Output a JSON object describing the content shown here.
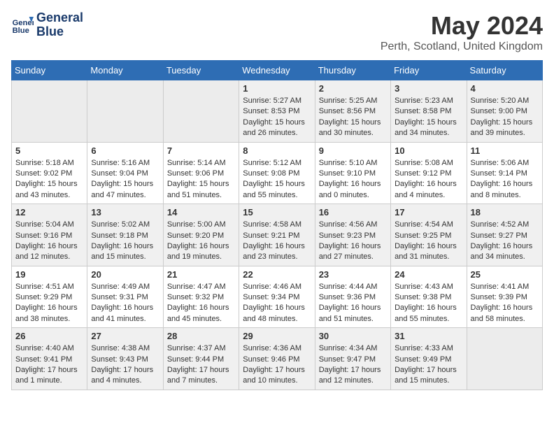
{
  "header": {
    "logo_line1": "General",
    "logo_line2": "Blue",
    "month_title": "May 2024",
    "location": "Perth, Scotland, United Kingdom"
  },
  "weekdays": [
    "Sunday",
    "Monday",
    "Tuesday",
    "Wednesday",
    "Thursday",
    "Friday",
    "Saturday"
  ],
  "rows": [
    [
      {
        "day": "",
        "info": ""
      },
      {
        "day": "",
        "info": ""
      },
      {
        "day": "",
        "info": ""
      },
      {
        "day": "1",
        "info": "Sunrise: 5:27 AM\nSunset: 8:53 PM\nDaylight: 15 hours\nand 26 minutes."
      },
      {
        "day": "2",
        "info": "Sunrise: 5:25 AM\nSunset: 8:56 PM\nDaylight: 15 hours\nand 30 minutes."
      },
      {
        "day": "3",
        "info": "Sunrise: 5:23 AM\nSunset: 8:58 PM\nDaylight: 15 hours\nand 34 minutes."
      },
      {
        "day": "4",
        "info": "Sunrise: 5:20 AM\nSunset: 9:00 PM\nDaylight: 15 hours\nand 39 minutes."
      }
    ],
    [
      {
        "day": "5",
        "info": "Sunrise: 5:18 AM\nSunset: 9:02 PM\nDaylight: 15 hours\nand 43 minutes."
      },
      {
        "day": "6",
        "info": "Sunrise: 5:16 AM\nSunset: 9:04 PM\nDaylight: 15 hours\nand 47 minutes."
      },
      {
        "day": "7",
        "info": "Sunrise: 5:14 AM\nSunset: 9:06 PM\nDaylight: 15 hours\nand 51 minutes."
      },
      {
        "day": "8",
        "info": "Sunrise: 5:12 AM\nSunset: 9:08 PM\nDaylight: 15 hours\nand 55 minutes."
      },
      {
        "day": "9",
        "info": "Sunrise: 5:10 AM\nSunset: 9:10 PM\nDaylight: 16 hours\nand 0 minutes."
      },
      {
        "day": "10",
        "info": "Sunrise: 5:08 AM\nSunset: 9:12 PM\nDaylight: 16 hours\nand 4 minutes."
      },
      {
        "day": "11",
        "info": "Sunrise: 5:06 AM\nSunset: 9:14 PM\nDaylight: 16 hours\nand 8 minutes."
      }
    ],
    [
      {
        "day": "12",
        "info": "Sunrise: 5:04 AM\nSunset: 9:16 PM\nDaylight: 16 hours\nand 12 minutes."
      },
      {
        "day": "13",
        "info": "Sunrise: 5:02 AM\nSunset: 9:18 PM\nDaylight: 16 hours\nand 15 minutes."
      },
      {
        "day": "14",
        "info": "Sunrise: 5:00 AM\nSunset: 9:20 PM\nDaylight: 16 hours\nand 19 minutes."
      },
      {
        "day": "15",
        "info": "Sunrise: 4:58 AM\nSunset: 9:21 PM\nDaylight: 16 hours\nand 23 minutes."
      },
      {
        "day": "16",
        "info": "Sunrise: 4:56 AM\nSunset: 9:23 PM\nDaylight: 16 hours\nand 27 minutes."
      },
      {
        "day": "17",
        "info": "Sunrise: 4:54 AM\nSunset: 9:25 PM\nDaylight: 16 hours\nand 31 minutes."
      },
      {
        "day": "18",
        "info": "Sunrise: 4:52 AM\nSunset: 9:27 PM\nDaylight: 16 hours\nand 34 minutes."
      }
    ],
    [
      {
        "day": "19",
        "info": "Sunrise: 4:51 AM\nSunset: 9:29 PM\nDaylight: 16 hours\nand 38 minutes."
      },
      {
        "day": "20",
        "info": "Sunrise: 4:49 AM\nSunset: 9:31 PM\nDaylight: 16 hours\nand 41 minutes."
      },
      {
        "day": "21",
        "info": "Sunrise: 4:47 AM\nSunset: 9:32 PM\nDaylight: 16 hours\nand 45 minutes."
      },
      {
        "day": "22",
        "info": "Sunrise: 4:46 AM\nSunset: 9:34 PM\nDaylight: 16 hours\nand 48 minutes."
      },
      {
        "day": "23",
        "info": "Sunrise: 4:44 AM\nSunset: 9:36 PM\nDaylight: 16 hours\nand 51 minutes."
      },
      {
        "day": "24",
        "info": "Sunrise: 4:43 AM\nSunset: 9:38 PM\nDaylight: 16 hours\nand 55 minutes."
      },
      {
        "day": "25",
        "info": "Sunrise: 4:41 AM\nSunset: 9:39 PM\nDaylight: 16 hours\nand 58 minutes."
      }
    ],
    [
      {
        "day": "26",
        "info": "Sunrise: 4:40 AM\nSunset: 9:41 PM\nDaylight: 17 hours\nand 1 minute."
      },
      {
        "day": "27",
        "info": "Sunrise: 4:38 AM\nSunset: 9:43 PM\nDaylight: 17 hours\nand 4 minutes."
      },
      {
        "day": "28",
        "info": "Sunrise: 4:37 AM\nSunset: 9:44 PM\nDaylight: 17 hours\nand 7 minutes."
      },
      {
        "day": "29",
        "info": "Sunrise: 4:36 AM\nSunset: 9:46 PM\nDaylight: 17 hours\nand 10 minutes."
      },
      {
        "day": "30",
        "info": "Sunrise: 4:34 AM\nSunset: 9:47 PM\nDaylight: 17 hours\nand 12 minutes."
      },
      {
        "day": "31",
        "info": "Sunrise: 4:33 AM\nSunset: 9:49 PM\nDaylight: 17 hours\nand 15 minutes."
      },
      {
        "day": "",
        "info": ""
      }
    ]
  ]
}
